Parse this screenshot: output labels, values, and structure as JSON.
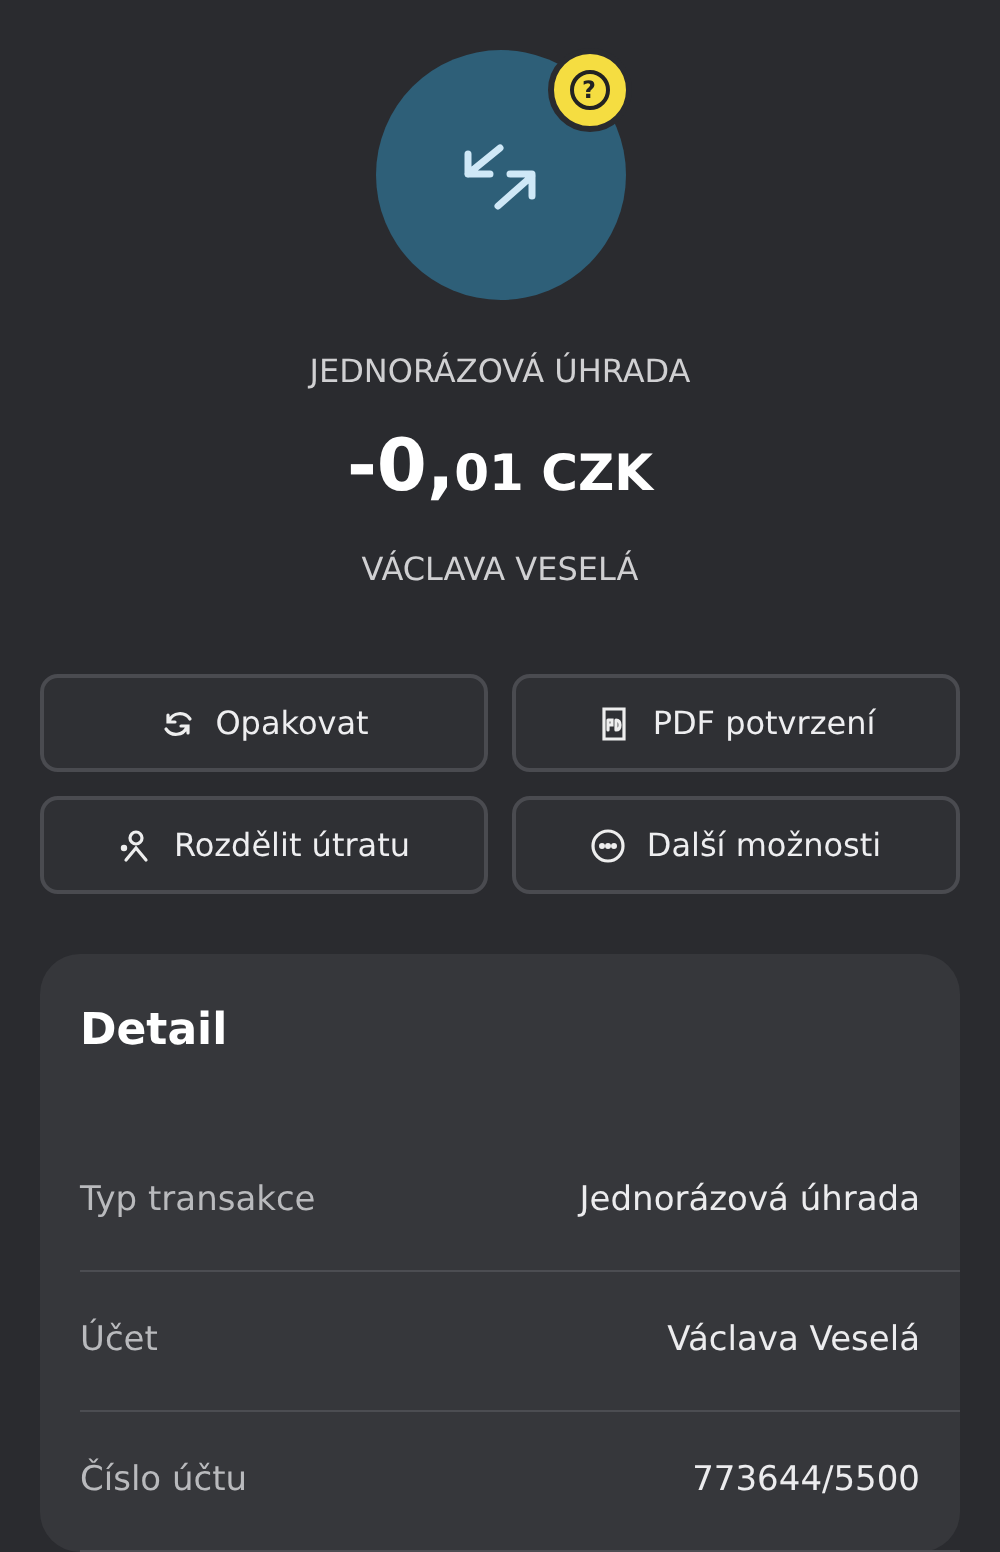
{
  "header": {
    "badge": "?",
    "type_label": "JEDNORÁZOVÁ ÚHRADA",
    "amount": {
      "whole": "-0,",
      "minor": "01 CZK"
    },
    "counterparty": "VÁCLAVA VESELÁ"
  },
  "actions": [
    {
      "label": "Opakovat"
    },
    {
      "label": "PDF potvrzení"
    },
    {
      "label": "Rozdělit útratu"
    },
    {
      "label": "Další možnosti"
    }
  ],
  "detail": {
    "title": "Detail",
    "rows": [
      {
        "label": "Typ transakce",
        "value": "Jednorázová úhrada"
      },
      {
        "label": "Účet",
        "value": "Václava Veselá"
      },
      {
        "label": "Číslo účtu",
        "value": "773644/5500"
      }
    ]
  }
}
